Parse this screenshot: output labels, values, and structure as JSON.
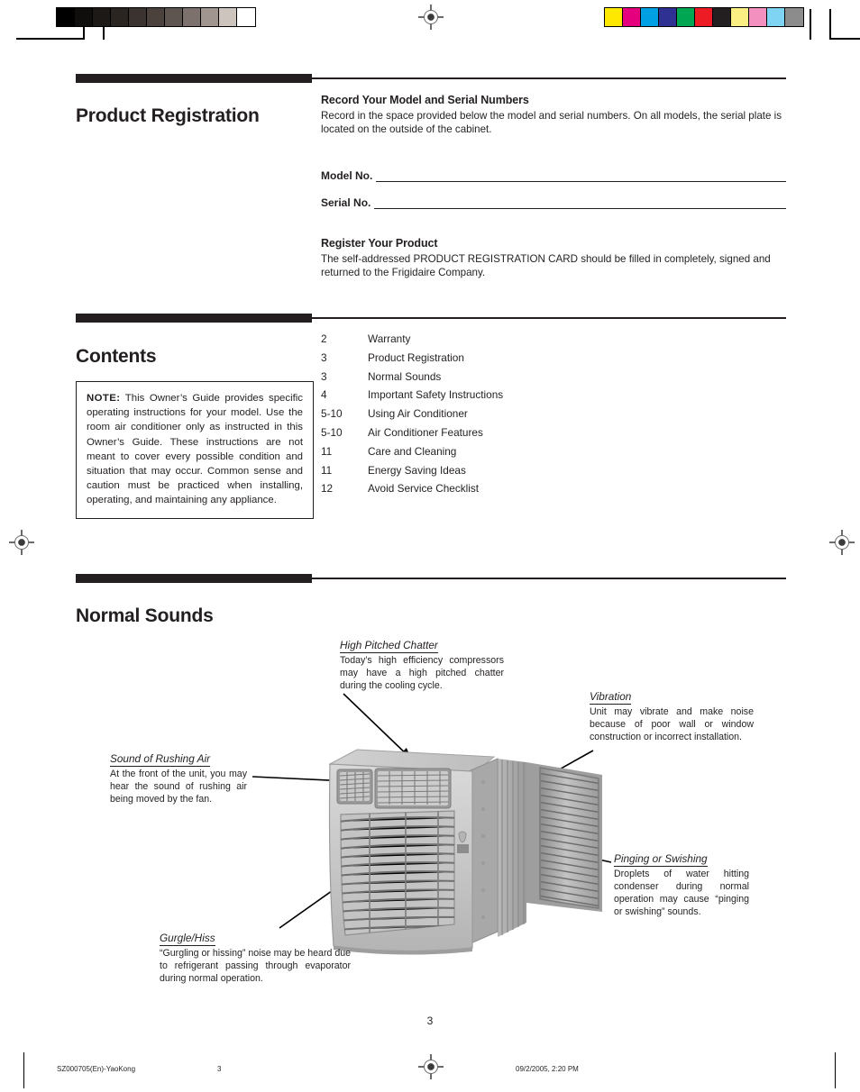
{
  "print_marks": {
    "grayscale_swatches": [
      "#000000",
      "#100d0d",
      "#1d1917",
      "#2b2522",
      "#3a332f",
      "#4b423d",
      "#5f5550",
      "#7c716c",
      "#a0958f",
      "#cdc4bd",
      "#ffffff"
    ],
    "color_swatches": [
      "#ffe800",
      "#e5007e",
      "#00a0e4",
      "#2e3192",
      "#00a651",
      "#ed1c24",
      "#231f20",
      "#fbef84",
      "#f490c0",
      "#7fd4f4",
      "#8c8c8c"
    ]
  },
  "product_registration": {
    "section_title": "Product Registration",
    "record_heading": "Record Your Model and Serial Numbers",
    "record_body": "Record in the space provided below the model and serial numbers. On all models, the serial plate is located on the outside of the cabinet.",
    "model_label": "Model No.",
    "serial_label": "Serial No.",
    "register_heading": "Register Your Product",
    "register_body": "The self-addressed PRODUCT REGISTRATION CARD should be filled in completely, signed and returned to the Frigidaire Company."
  },
  "contents": {
    "section_title": "Contents",
    "note_label": "NOTE:",
    "note_body": " This Owner’s Guide provides specific operating instructions for your model. Use the room air conditioner only as instructed in this Owner’s Guide. These instructions are not meant to cover every possible condition and situation that may occur. Common sense and caution must be practiced when installing, operating, and maintaining any appliance.",
    "entries": [
      {
        "page": "2",
        "label": "Warranty"
      },
      {
        "page": "3",
        "label": "Product Registration"
      },
      {
        "page": "3",
        "label": "Normal Sounds"
      },
      {
        "page": "4",
        "label": "Important Safety Instructions"
      },
      {
        "page": "5-10",
        "label": "Using Air Conditioner"
      },
      {
        "page": "5-10",
        "label": "Air Conditioner Features"
      },
      {
        "page": "11",
        "label": "Care and Cleaning"
      },
      {
        "page": "11",
        "label": "Energy Saving Ideas"
      },
      {
        "page": "12",
        "label": "Avoid Service Checklist"
      }
    ]
  },
  "normal_sounds": {
    "section_title": "Normal Sounds",
    "callouts": [
      {
        "title": "High Pitched Chatter",
        "body": "Today’s high efficiency compressors may have a high pitched chatter during the cooling cycle."
      },
      {
        "title": "Vibration",
        "body": "Unit may vibrate and make noise because of poor wall or window construction or incorrect installation."
      },
      {
        "title": "Sound of Rushing Air",
        "body": "At the front of the unit, you may hear the sound of rushing air being moved by the fan."
      },
      {
        "title": "Pinging or Swishing",
        "body": "Droplets of water hitting condenser during normal operation may cause “pinging or swishing” sounds."
      },
      {
        "title": "Gurgle/Hiss",
        "body": " “Gurgling or hissing” noise may be heard due to refrigerant passing through evaporator during normal operation."
      }
    ]
  },
  "page_number": "3",
  "footer": {
    "filename": "SZ000705(En)-YaoKong",
    "page": "3",
    "timestamp": "09/2/2005, 2:20 PM"
  }
}
